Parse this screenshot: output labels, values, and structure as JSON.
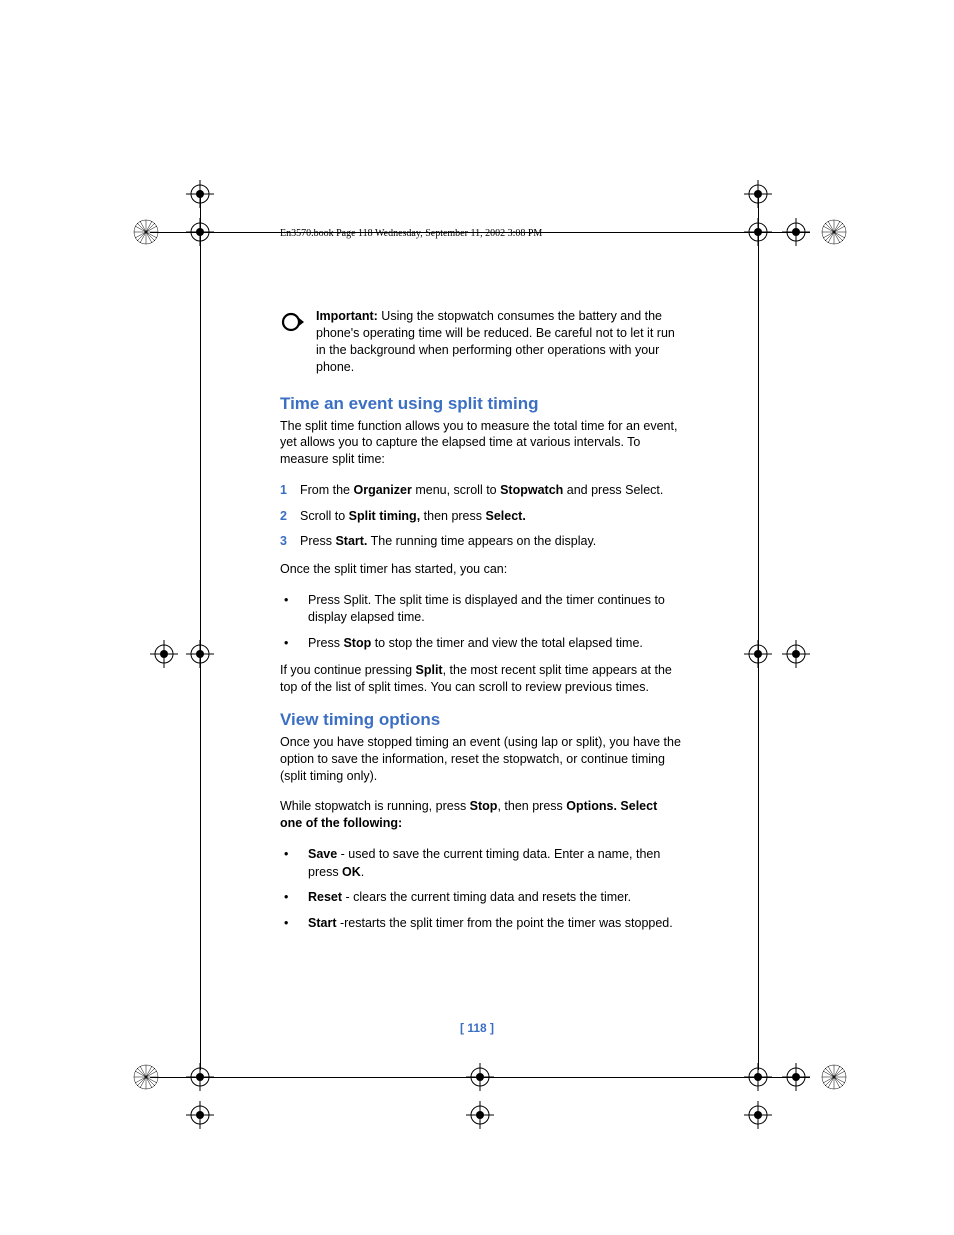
{
  "header": "En3570.book  Page 118  Wednesday, September 11, 2002  3:08 PM",
  "important": {
    "label": "Important:",
    "text": " Using the stopwatch consumes the battery and the phone's operating time will be reduced. Be careful not to let it run in the background when performing other operations with your phone."
  },
  "section1": {
    "title": "Time an event using split timing",
    "intro": "The split time function allows you to measure the total time for an event, yet allows you to capture the elapsed time at various intervals. To measure split time:",
    "steps": [
      {
        "num": "1",
        "pre": "From the ",
        "b1": "Organizer",
        "mid": " menu, scroll to ",
        "b2": "Stopwatch",
        "post": " and press Select."
      },
      {
        "num": "2",
        "pre": "Scroll to ",
        "b1": "Split timing,",
        "mid": " then press ",
        "b2": "Select.",
        "post": ""
      },
      {
        "num": "3",
        "pre": "Press ",
        "b1": "Start.",
        "mid": " The running time appears on the display.",
        "b2": "",
        "post": ""
      }
    ],
    "after_steps": "Once the split timer has started, you can:",
    "bullets": [
      {
        "pre": "Press Split. The split time is displayed and the timer continues to display elapsed time.",
        "b1": "",
        "post": ""
      },
      {
        "pre": "Press ",
        "b1": "Stop",
        "post": " to stop the timer and view the total elapsed time."
      }
    ],
    "outro_pre": "If you continue pressing ",
    "outro_b": "Split",
    "outro_post": ", the most recent split time appears at the top of the list of split times. You can scroll to review previous times."
  },
  "section2": {
    "title": "View timing options",
    "intro": "Once you have stopped timing an event (using lap or split), you have the option to save the information, reset the stopwatch, or continue timing (split timing only).",
    "para2_pre": "While stopwatch is running, press ",
    "para2_b1": "Stop",
    "para2_mid": ", then press ",
    "para2_b2": "Options. Select one of the following:",
    "bullets": [
      {
        "b1": "Save",
        "mid": " - used to save the current timing data. Enter a name, then press ",
        "b2": "OK",
        "post": "."
      },
      {
        "b1": "Reset",
        "mid": " - clears the current timing data and resets the timer.",
        "b2": "",
        "post": ""
      },
      {
        "b1": "Start",
        "mid": " -restarts the split timer from the point the timer was stopped.",
        "b2": "",
        "post": ""
      }
    ]
  },
  "page_number": "[ 118 ]"
}
